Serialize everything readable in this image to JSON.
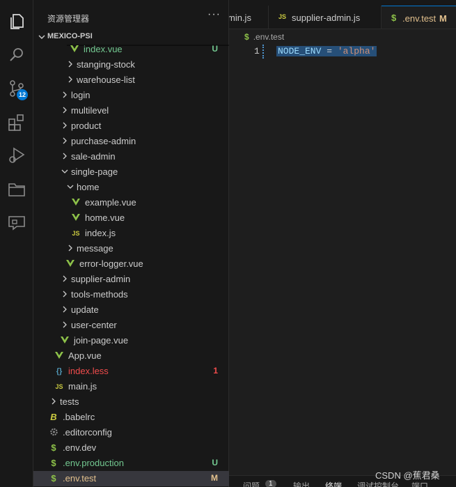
{
  "activity_bar": {
    "icons": [
      "explorer-icon",
      "search-icon",
      "source-control-icon",
      "extensions-icon",
      "run-debug-icon",
      "folder-icon",
      "remote-chat-icon"
    ],
    "source_control_badge": "12"
  },
  "sidebar": {
    "title": "资源管理器",
    "more": "···",
    "section": "MEXICO-PSI",
    "items": [
      {
        "label": "index.vue",
        "type": "vue",
        "badge": "U",
        "color": "#73c991"
      },
      {
        "label": "stanging-stock",
        "type": "folder-closed"
      },
      {
        "label": "warehouse-list",
        "type": "folder-closed"
      },
      {
        "label": "login",
        "type": "folder-closed"
      },
      {
        "label": "multilevel",
        "type": "folder-closed"
      },
      {
        "label": "product",
        "type": "folder-closed"
      },
      {
        "label": "purchase-admin",
        "type": "folder-closed"
      },
      {
        "label": "sale-admin",
        "type": "folder-closed"
      },
      {
        "label": "single-page",
        "type": "folder-open"
      },
      {
        "label": "home",
        "type": "folder-open"
      },
      {
        "label": "example.vue",
        "type": "vue"
      },
      {
        "label": "home.vue",
        "type": "vue"
      },
      {
        "label": "index.js",
        "type": "js"
      },
      {
        "label": "message",
        "type": "folder-closed"
      },
      {
        "label": "error-logger.vue",
        "type": "vue"
      },
      {
        "label": "supplier-admin",
        "type": "folder-closed"
      },
      {
        "label": "tools-methods",
        "type": "folder-closed"
      },
      {
        "label": "update",
        "type": "folder-closed"
      },
      {
        "label": "user-center",
        "type": "folder-closed"
      },
      {
        "label": "join-page.vue",
        "type": "vue"
      },
      {
        "label": "App.vue",
        "type": "vue"
      },
      {
        "label": "index.less",
        "type": "less",
        "badge": "1",
        "color": "#f14c4c"
      },
      {
        "label": "main.js",
        "type": "js"
      },
      {
        "label": "tests",
        "type": "folder-closed"
      },
      {
        "label": ".babelrc",
        "type": "babel"
      },
      {
        "label": ".editorconfig",
        "type": "gear"
      },
      {
        "label": ".env.dev",
        "type": "env"
      },
      {
        "label": ".env.production",
        "type": "env",
        "badge": "U",
        "color": "#73c991"
      },
      {
        "label": ".env.test",
        "type": "env",
        "badge": "M",
        "color": "#e2c08d",
        "selected": true
      }
    ]
  },
  "tabs": [
    {
      "label": "min.js",
      "type": "js"
    },
    {
      "label": "supplier-admin.js",
      "type": "js"
    },
    {
      "label": ".env.test",
      "type": "env",
      "badge": "M",
      "active": true
    }
  ],
  "editor": {
    "breadcrumb": ".env.test",
    "breadcrumb_icon": "$",
    "line_number": "1",
    "code": "NODE_ENV = 'alpha'"
  },
  "panel": {
    "tabs": [
      "问题",
      "1",
      "输出",
      "终端",
      "调试控制台",
      "端口"
    ]
  },
  "watermark": "CSDN @蕉君桑",
  "colors": {
    "vue": "#8dc149",
    "js": "#cbcb41",
    "env": "#8dc149",
    "less": "#519aba",
    "modified": "#e2c08d",
    "untracked": "#73c991",
    "error": "#f14c4c"
  }
}
